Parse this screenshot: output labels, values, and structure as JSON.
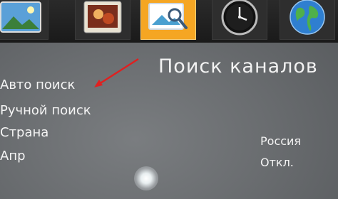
{
  "tabs": [
    {
      "icon": "photo-icon",
      "active": false
    },
    {
      "icon": "picture-icon",
      "active": false
    },
    {
      "icon": "image-search-icon",
      "active": true
    },
    {
      "icon": "clock-icon",
      "active": false
    },
    {
      "icon": "globe-icon",
      "active": false
    }
  ],
  "page": {
    "title": "Поиск каналов"
  },
  "menu": {
    "items": [
      {
        "label": "Авто поиск"
      },
      {
        "label": "Ручной поиск"
      },
      {
        "label": "Страна",
        "value": "Россия"
      },
      {
        "label": "Апр",
        "value": "Откл."
      }
    ]
  },
  "colors": {
    "active_tab": "#f5a623",
    "arrow": "#e02020",
    "text": "#f4f4f4"
  }
}
